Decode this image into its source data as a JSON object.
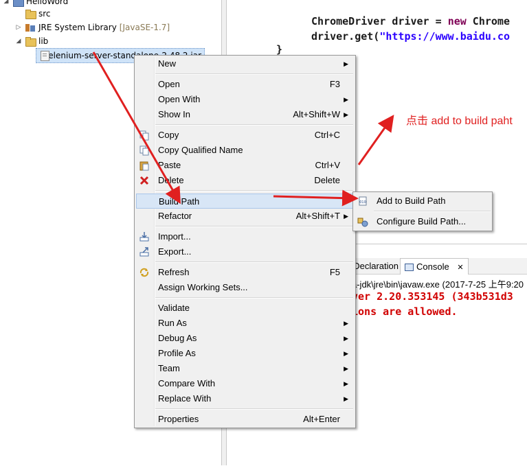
{
  "explorer": {
    "items": [
      {
        "label": "HelloWord",
        "icon": "project-icon"
      },
      {
        "label": "src",
        "icon": "package-folder-icon"
      },
      {
        "label": "JRE System Library",
        "suffix": "[JavaSE-1.7]",
        "icon": "library-icon"
      },
      {
        "label": "lib",
        "icon": "folder-icon"
      },
      {
        "label": "selenium-server-standalone-2.48.2.jar",
        "icon": "jar-icon"
      }
    ]
  },
  "editor": {
    "line1_type": "ChromeDriver driver = ",
    "line1_kw": "new",
    "line1_rest": " Chrome",
    "line2_call": "driver.get(",
    "line2_str": "\"https://www.baidu.co",
    "line3": "}"
  },
  "console": {
    "tab_declaration": "Declaration",
    "tab_console": "Console",
    "tab_close": "✕",
    "path_line": "a-jdk\\jre\\bin\\javaw.exe (2017-7-25 上午9:20",
    "err_line1": "ver 2.20.353145 (343b531d3",
    "err_line2": "ions are allowed."
  },
  "context_menu": {
    "items": [
      {
        "label": "New",
        "shortcut": "",
        "submenu": true
      },
      {
        "label": "Open",
        "shortcut": "F3",
        "submenu": false
      },
      {
        "label": "Open With",
        "shortcut": "",
        "submenu": true
      },
      {
        "label": "Show In",
        "shortcut": "Alt+Shift+W",
        "submenu": true
      },
      {
        "label": "Copy",
        "shortcut": "Ctrl+C",
        "submenu": false
      },
      {
        "label": "Copy Qualified Name",
        "shortcut": "",
        "submenu": false
      },
      {
        "label": "Paste",
        "shortcut": "Ctrl+V",
        "submenu": false
      },
      {
        "label": "Delete",
        "shortcut": "Delete",
        "submenu": false
      },
      {
        "label": "Build Path",
        "shortcut": "",
        "submenu": true
      },
      {
        "label": "Refactor",
        "shortcut": "Alt+Shift+T",
        "submenu": true
      },
      {
        "label": "Import...",
        "shortcut": "",
        "submenu": false
      },
      {
        "label": "Export...",
        "shortcut": "",
        "submenu": false
      },
      {
        "label": "Refresh",
        "shortcut": "F5",
        "submenu": false
      },
      {
        "label": "Assign Working Sets...",
        "shortcut": "",
        "submenu": false
      },
      {
        "label": "Validate",
        "shortcut": "",
        "submenu": false
      },
      {
        "label": "Run As",
        "shortcut": "",
        "submenu": true
      },
      {
        "label": "Debug As",
        "shortcut": "",
        "submenu": true
      },
      {
        "label": "Profile As",
        "shortcut": "",
        "submenu": true
      },
      {
        "label": "Team",
        "shortcut": "",
        "submenu": true
      },
      {
        "label": "Compare With",
        "shortcut": "",
        "submenu": true
      },
      {
        "label": "Replace With",
        "shortcut": "",
        "submenu": true
      },
      {
        "label": "Properties",
        "shortcut": "Alt+Enter",
        "submenu": false
      }
    ]
  },
  "submenu": {
    "items": [
      {
        "label": "Add to Build Path"
      },
      {
        "label": "Configure Build Path..."
      }
    ]
  },
  "annotation": {
    "text": "点击 add to build paht",
    "color": "#e02020"
  }
}
